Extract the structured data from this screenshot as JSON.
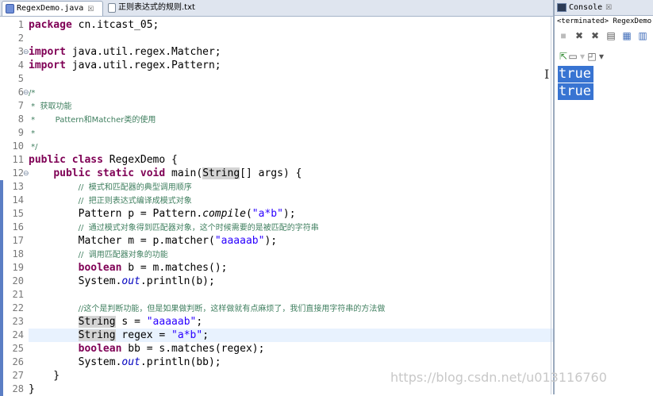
{
  "editor": {
    "tabs": [
      {
        "label": "RegexDemo.java",
        "close": "☒",
        "icon": "java-file-icon",
        "active": true
      },
      {
        "label": "正则表达式的规则.txt",
        "icon": "text-file-icon",
        "active": false
      }
    ],
    "lines": [
      {
        "n": "1",
        "fold": "",
        "tokens": [
          {
            "t": "package",
            "c": "kw"
          },
          {
            "t": " cn.itcast_05;"
          }
        ]
      },
      {
        "n": "2",
        "fold": "",
        "tokens": []
      },
      {
        "n": "3",
        "fold": "⊖",
        "tokens": [
          {
            "t": "import",
            "c": "kw"
          },
          {
            "t": " java.util.regex.Matcher;"
          }
        ]
      },
      {
        "n": "4",
        "fold": "",
        "tokens": [
          {
            "t": "import",
            "c": "kw"
          },
          {
            "t": " java.util.regex.Pattern;"
          }
        ]
      },
      {
        "n": "5",
        "fold": "",
        "tokens": []
      },
      {
        "n": "6",
        "fold": "⊖",
        "tokens": [
          {
            "t": "/*",
            "c": "cm"
          }
        ]
      },
      {
        "n": "7",
        "fold": "",
        "tokens": [
          {
            "t": " *  获取功能",
            "c": "cm"
          }
        ]
      },
      {
        "n": "8",
        "fold": "",
        "tokens": [
          {
            "t": " *        Pattern和Matcher类的使用",
            "c": "cm"
          }
        ]
      },
      {
        "n": "9",
        "fold": "",
        "tokens": [
          {
            "t": " *",
            "c": "cm"
          }
        ]
      },
      {
        "n": "10",
        "fold": "",
        "tokens": [
          {
            "t": " */",
            "c": "cm"
          }
        ]
      },
      {
        "n": "11",
        "fold": "",
        "tokens": [
          {
            "t": "public",
            "c": "kw"
          },
          {
            "t": " "
          },
          {
            "t": "class",
            "c": "kw"
          },
          {
            "t": " RegexDemo {"
          }
        ]
      },
      {
        "n": "12",
        "fold": "⊖",
        "tokens": [
          {
            "t": "    "
          },
          {
            "t": "public",
            "c": "kw"
          },
          {
            "t": " "
          },
          {
            "t": "static",
            "c": "kw"
          },
          {
            "t": " "
          },
          {
            "t": "void",
            "c": "kw"
          },
          {
            "t": " main("
          },
          {
            "t": "String",
            "c": "occ"
          },
          {
            "t": "[] args) {"
          }
        ]
      },
      {
        "n": "13",
        "fold": "",
        "tokens": [
          {
            "t": "        "
          },
          {
            "t": "//  模式和匹配器的典型调用顺序",
            "c": "cm"
          }
        ]
      },
      {
        "n": "14",
        "fold": "",
        "tokens": [
          {
            "t": "        "
          },
          {
            "t": "//  把正则表达式编译成模式对象",
            "c": "cm"
          }
        ]
      },
      {
        "n": "15",
        "fold": "",
        "tokens": [
          {
            "t": "        Pattern p = Pattern."
          },
          {
            "t": "compile",
            "c": "it"
          },
          {
            "t": "("
          },
          {
            "t": "\"a*b\"",
            "c": "str"
          },
          {
            "t": ");"
          }
        ]
      },
      {
        "n": "16",
        "fold": "",
        "tokens": [
          {
            "t": "        "
          },
          {
            "t": "//  通过模式对象得到匹配器对象，这个时候需要的是被匹配的字符串",
            "c": "cm"
          }
        ]
      },
      {
        "n": "17",
        "fold": "",
        "tokens": [
          {
            "t": "        Matcher m = p.matcher("
          },
          {
            "t": "\"aaaaab\"",
            "c": "str"
          },
          {
            "t": ");"
          }
        ]
      },
      {
        "n": "18",
        "fold": "",
        "tokens": [
          {
            "t": "        "
          },
          {
            "t": "//  调用匹配器对象的功能",
            "c": "cm"
          }
        ]
      },
      {
        "n": "19",
        "fold": "",
        "tokens": [
          {
            "t": "        "
          },
          {
            "t": "boolean",
            "c": "kw"
          },
          {
            "t": " b = m.matches();"
          }
        ]
      },
      {
        "n": "20",
        "fold": "",
        "tokens": [
          {
            "t": "        System."
          },
          {
            "t": "out",
            "c": "fld"
          },
          {
            "t": ".println(b);"
          }
        ]
      },
      {
        "n": "21",
        "fold": "",
        "tokens": []
      },
      {
        "n": "22",
        "fold": "",
        "tokens": [
          {
            "t": "        "
          },
          {
            "t": "//这个是判断功能，但是如果做判断，这样做就有点麻烦了，我们直接用字符串的方法做",
            "c": "cm"
          }
        ]
      },
      {
        "n": "23",
        "fold": "",
        "tokens": [
          {
            "t": "        "
          },
          {
            "t": "String",
            "c": "occ"
          },
          {
            "t": " s = "
          },
          {
            "t": "\"aaaaab\"",
            "c": "str"
          },
          {
            "t": ";"
          }
        ]
      },
      {
        "n": "24",
        "fold": "",
        "current": true,
        "tokens": [
          {
            "t": "        "
          },
          {
            "t": "String",
            "c": "occ"
          },
          {
            "t": " regex = "
          },
          {
            "t": "\"a*b\"",
            "c": "str"
          },
          {
            "t": ";"
          }
        ]
      },
      {
        "n": "25",
        "fold": "",
        "tokens": [
          {
            "t": "        "
          },
          {
            "t": "boolean",
            "c": "kw"
          },
          {
            "t": " bb = s.matches(regex);"
          }
        ]
      },
      {
        "n": "26",
        "fold": "",
        "tokens": [
          {
            "t": "        System."
          },
          {
            "t": "out",
            "c": "fld"
          },
          {
            "t": ".println(bb);"
          }
        ]
      },
      {
        "n": "27",
        "fold": "",
        "tokens": [
          {
            "t": "    }"
          }
        ]
      },
      {
        "n": "28",
        "fold": "",
        "tokens": [
          {
            "t": "}"
          }
        ]
      }
    ]
  },
  "console": {
    "tab_label": "Console",
    "tab_close": "☒",
    "status": "<terminated> RegexDemo",
    "toolbar_row1": [
      {
        "name": "terminate-icon",
        "glyph": "■",
        "style": "dim"
      },
      {
        "name": "remove-launch-icon",
        "glyph": "✖",
        "style": "dark"
      },
      {
        "name": "remove-all-launches-icon",
        "glyph": "✖",
        "style": "dark"
      },
      {
        "name": "clear-console-icon",
        "glyph": "▤",
        "style": "dark"
      },
      {
        "name": "scroll-lock-icon",
        "glyph": "▦",
        "style": "blue"
      },
      {
        "name": "word-wrap-icon",
        "glyph": "▥",
        "style": "blue"
      }
    ],
    "toolbar_row2": [
      {
        "name": "pin-console-icon",
        "glyph": "⇱",
        "style": "green"
      },
      {
        "name": "display-selected-console-icon",
        "glyph": "▭",
        "style": "dark"
      },
      {
        "name": "dropdown-arrow-icon",
        "glyph": "▾",
        "style": "dim"
      },
      {
        "name": "open-console-icon",
        "glyph": "◰",
        "style": "dark"
      },
      {
        "name": "dropdown-arrow-icon",
        "glyph": "▾",
        "style": "dark"
      }
    ],
    "output": [
      "true",
      "true"
    ]
  },
  "watermark": "https://blog.csdn.net/u013116760"
}
